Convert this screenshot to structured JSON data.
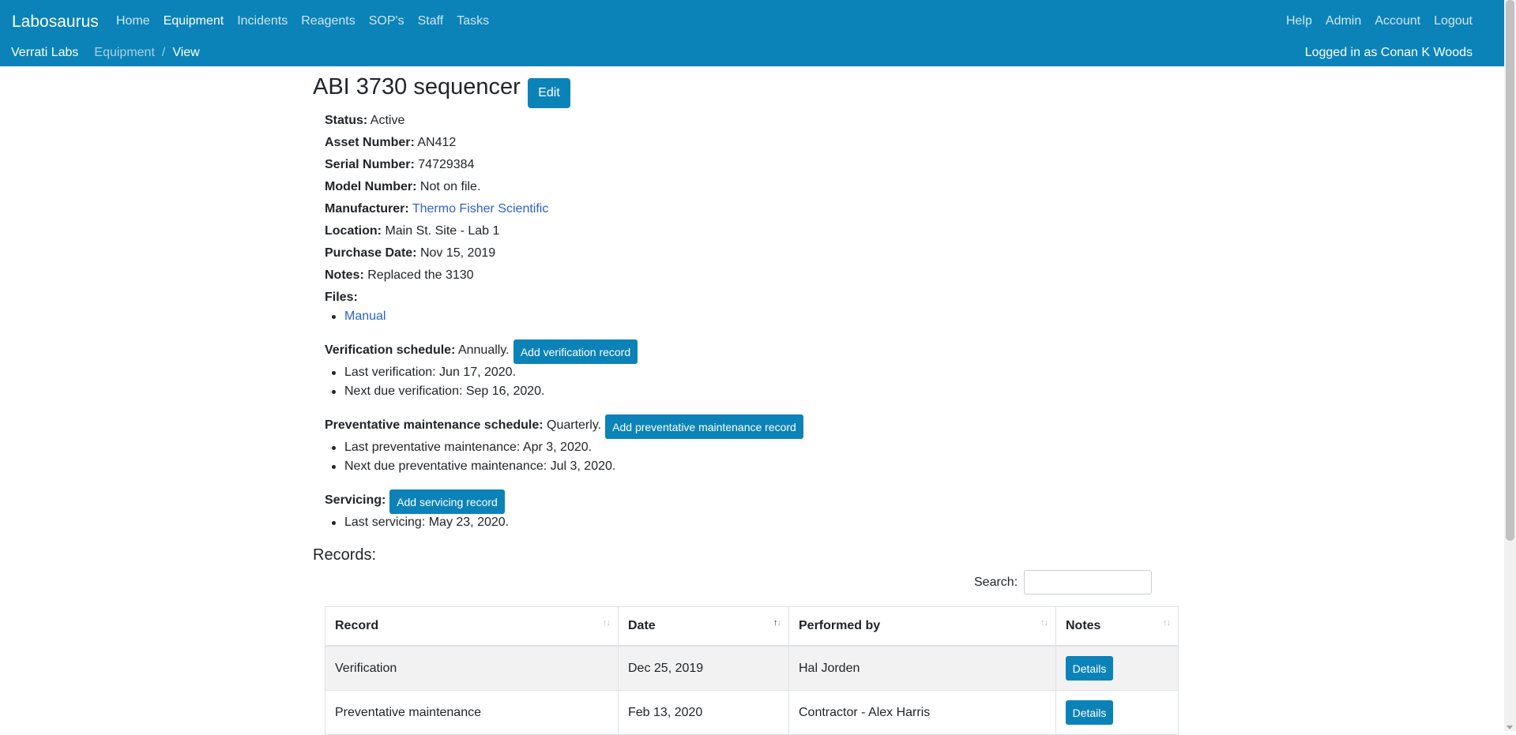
{
  "nav": {
    "brand": "Labosaurus",
    "left": [
      "Home",
      "Equipment",
      "Incidents",
      "Reagents",
      "SOP's",
      "Staff",
      "Tasks"
    ],
    "active": "Equipment",
    "right": [
      "Help",
      "Admin",
      "Account",
      "Logout"
    ]
  },
  "breadcrumb": {
    "home": "Verrati Labs",
    "section": "Equipment",
    "current": "View",
    "separator": "/"
  },
  "user": {
    "logged_in": "Logged in as Conan K Woods"
  },
  "equipment": {
    "title": "ABI 3730 sequencer",
    "edit_label": "Edit",
    "status_label": "Status:",
    "status": "Active",
    "asset_label": "Asset Number:",
    "asset": "AN412",
    "serial_label": "Serial Number:",
    "serial": "74729384",
    "model_label": "Model Number:",
    "model": "Not on file.",
    "manufacturer_label": "Manufacturer:",
    "manufacturer": "Thermo Fisher Scientific",
    "location_label": "Location:",
    "location": "Main St. Site - Lab 1",
    "purchase_label": "Purchase Date:",
    "purchase": "Nov 15, 2019",
    "notes_label": "Notes:",
    "notes": "Replaced the 3130",
    "files_label": "Files:",
    "files": [
      "Manual"
    ]
  },
  "verification": {
    "label": "Verification schedule:",
    "schedule": "Annually.",
    "button": "Add verification record",
    "last": "Last verification: Jun 17, 2020.",
    "next": "Next due verification: Sep 16, 2020."
  },
  "maintenance": {
    "label": "Preventative maintenance schedule:",
    "schedule": "Quarterly.",
    "button": "Add preventative maintenance record",
    "last": "Last preventative maintenance: Apr 3, 2020.",
    "next": "Next due preventative maintenance: Jul 3, 2020."
  },
  "servicing": {
    "label": "Servicing:",
    "button": "Add servicing record",
    "last": "Last servicing: May 23, 2020."
  },
  "records": {
    "heading": "Records:",
    "search_label": "Search:",
    "search_value": "",
    "columns": [
      "Record",
      "Date",
      "Performed by",
      "Notes"
    ],
    "sorted_column": "Date",
    "rows": [
      {
        "record": "Verification",
        "date": "Dec 25, 2019",
        "performed_by": "Hal Jorden",
        "notes_button": "Details"
      },
      {
        "record": "Preventative maintenance",
        "date": "Feb 13, 2020",
        "performed_by": "Contractor - Alex Harris",
        "notes_button": "Details"
      }
    ]
  },
  "colors": {
    "navbar": "#0b83b8",
    "button": "#0b83b8",
    "link": "#2a62c9",
    "row_stripe": "#f2f2f2"
  }
}
